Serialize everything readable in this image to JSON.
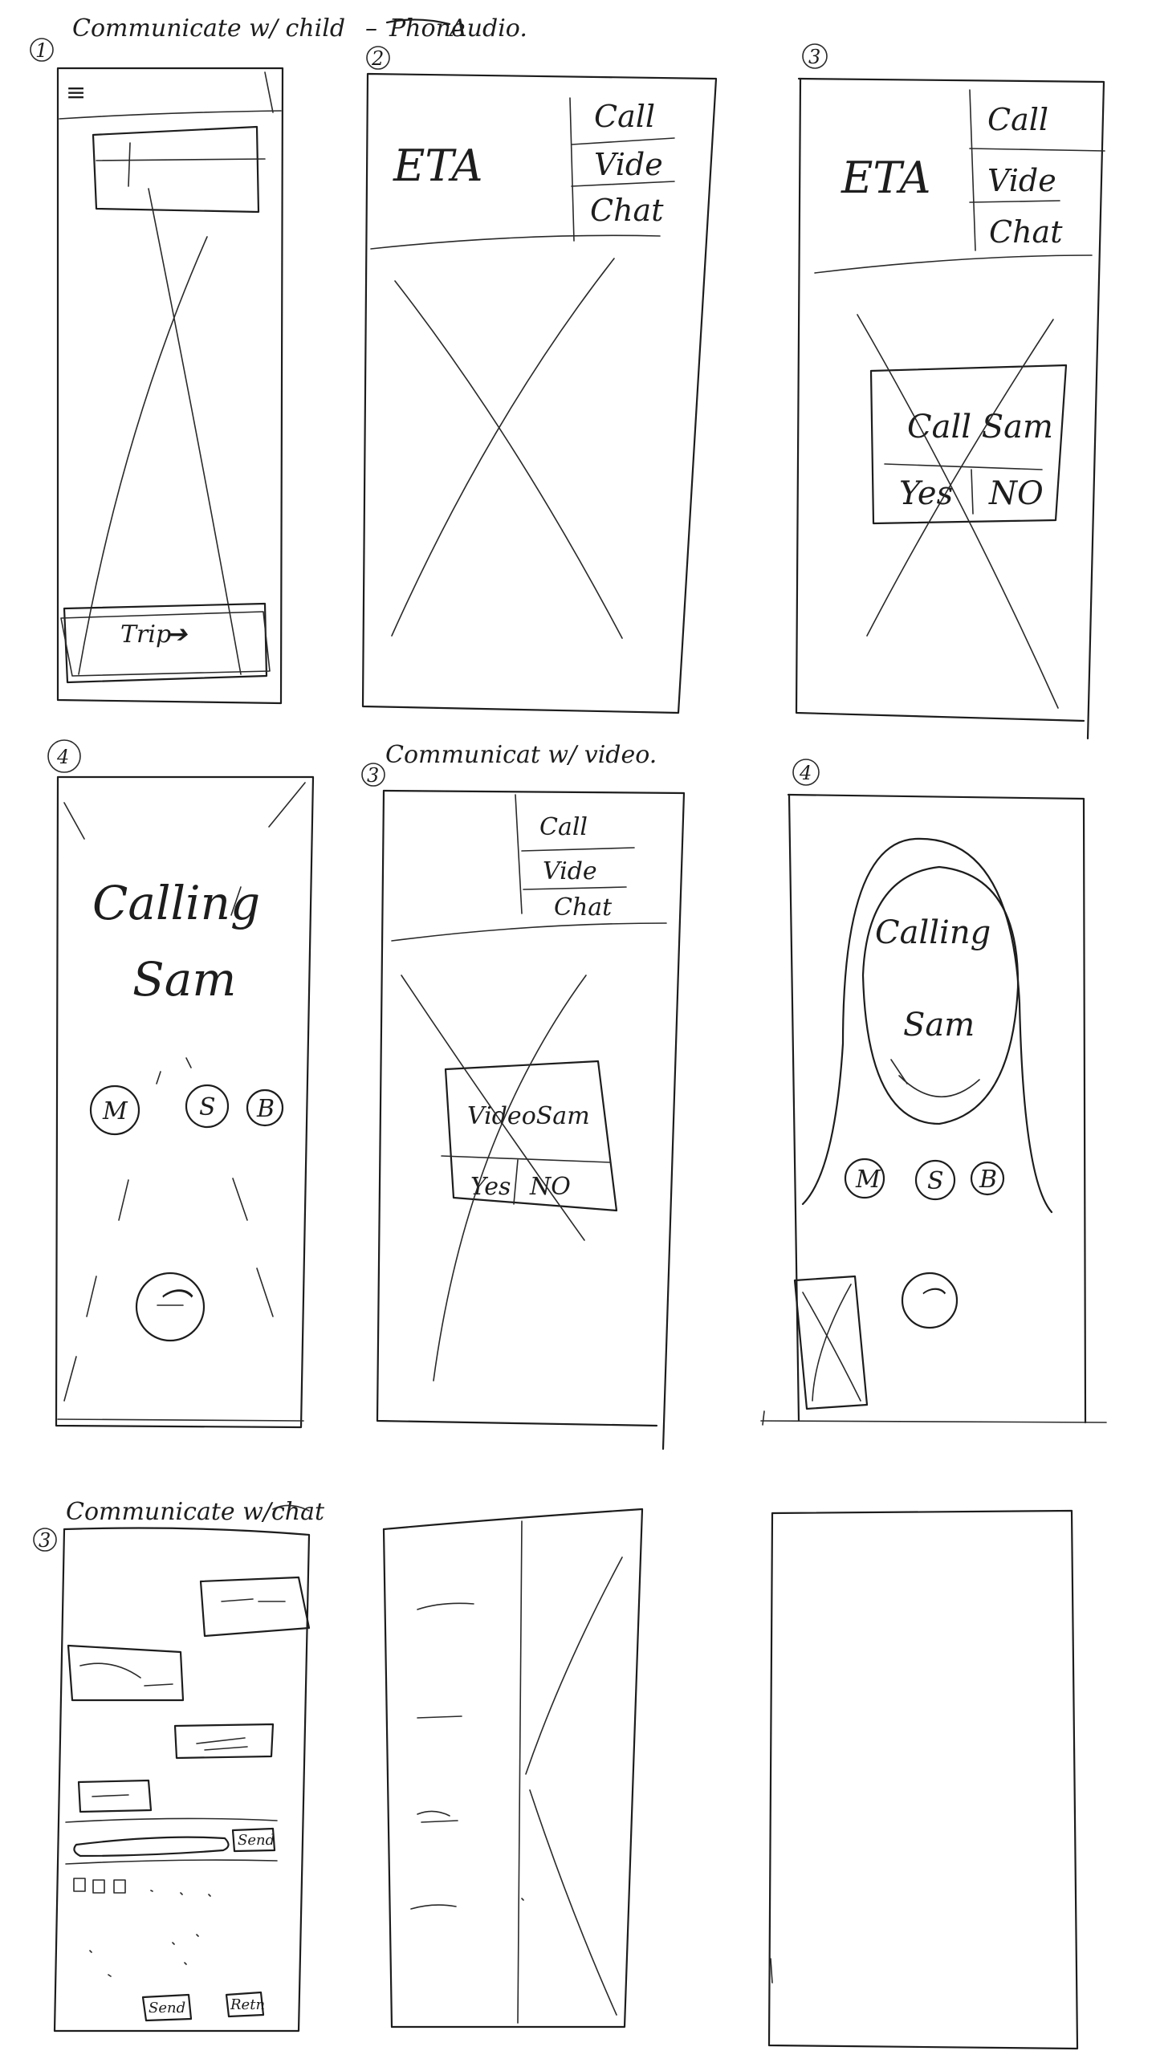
{
  "headings": {
    "audio": "Communicate w/ child",
    "audio_dash": "–",
    "audio_struck": "Phone",
    "audio_mode": "Audio.",
    "video": "Communicat w/ video.",
    "chat": "Communicate w/chat"
  },
  "frame_numbers": [
    "1",
    "2",
    "3",
    "4",
    "3",
    "4",
    "3"
  ],
  "frame1": {
    "menu_glyph": "≡",
    "trip_button": "Trip",
    "trip_arrow": "➔"
  },
  "frame2": {
    "eta": "ETA",
    "menu": [
      "Call",
      "Vide",
      "Chat"
    ]
  },
  "frame3": {
    "eta": "ETA",
    "menu": [
      "Call",
      "Vide",
      "Chat"
    ],
    "dialog_title": "Call Sam",
    "yes": "Yes",
    "no": "NO"
  },
  "frame4": {
    "calling": "Calling",
    "name": "Sam",
    "buttons": [
      "M",
      "S",
      "B"
    ],
    "hangup": "⌒"
  },
  "frame5": {
    "menu": [
      "Call",
      "Vide",
      "Chat"
    ],
    "dialog_title": "VideoSam",
    "yes": "Yes",
    "no": "NO"
  },
  "frame6": {
    "calling": "Calling",
    "name": "Sam",
    "buttons": [
      "M",
      "S",
      "B"
    ],
    "hangup": "⌒"
  },
  "frame7": {
    "send": "Send",
    "send_bottom": "Send",
    "return": "Retn"
  }
}
